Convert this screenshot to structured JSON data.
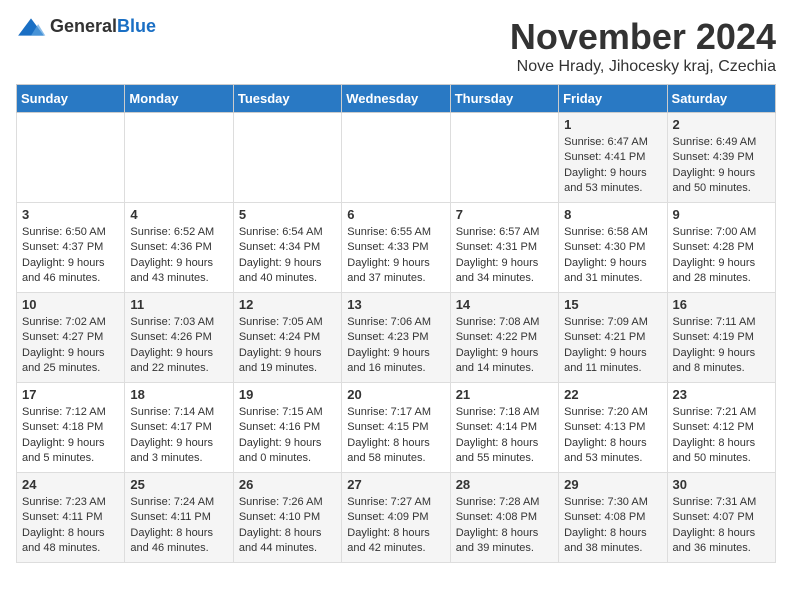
{
  "logo": {
    "general": "General",
    "blue": "Blue"
  },
  "title": "November 2024",
  "location": "Nove Hrady, Jihocesky kraj, Czechia",
  "weekdays": [
    "Sunday",
    "Monday",
    "Tuesday",
    "Wednesday",
    "Thursday",
    "Friday",
    "Saturday"
  ],
  "weeks": [
    [
      {
        "day": "",
        "info": ""
      },
      {
        "day": "",
        "info": ""
      },
      {
        "day": "",
        "info": ""
      },
      {
        "day": "",
        "info": ""
      },
      {
        "day": "",
        "info": ""
      },
      {
        "day": "1",
        "info": "Sunrise: 6:47 AM\nSunset: 4:41 PM\nDaylight: 9 hours\nand 53 minutes."
      },
      {
        "day": "2",
        "info": "Sunrise: 6:49 AM\nSunset: 4:39 PM\nDaylight: 9 hours\nand 50 minutes."
      }
    ],
    [
      {
        "day": "3",
        "info": "Sunrise: 6:50 AM\nSunset: 4:37 PM\nDaylight: 9 hours\nand 46 minutes."
      },
      {
        "day": "4",
        "info": "Sunrise: 6:52 AM\nSunset: 4:36 PM\nDaylight: 9 hours\nand 43 minutes."
      },
      {
        "day": "5",
        "info": "Sunrise: 6:54 AM\nSunset: 4:34 PM\nDaylight: 9 hours\nand 40 minutes."
      },
      {
        "day": "6",
        "info": "Sunrise: 6:55 AM\nSunset: 4:33 PM\nDaylight: 9 hours\nand 37 minutes."
      },
      {
        "day": "7",
        "info": "Sunrise: 6:57 AM\nSunset: 4:31 PM\nDaylight: 9 hours\nand 34 minutes."
      },
      {
        "day": "8",
        "info": "Sunrise: 6:58 AM\nSunset: 4:30 PM\nDaylight: 9 hours\nand 31 minutes."
      },
      {
        "day": "9",
        "info": "Sunrise: 7:00 AM\nSunset: 4:28 PM\nDaylight: 9 hours\nand 28 minutes."
      }
    ],
    [
      {
        "day": "10",
        "info": "Sunrise: 7:02 AM\nSunset: 4:27 PM\nDaylight: 9 hours\nand 25 minutes."
      },
      {
        "day": "11",
        "info": "Sunrise: 7:03 AM\nSunset: 4:26 PM\nDaylight: 9 hours\nand 22 minutes."
      },
      {
        "day": "12",
        "info": "Sunrise: 7:05 AM\nSunset: 4:24 PM\nDaylight: 9 hours\nand 19 minutes."
      },
      {
        "day": "13",
        "info": "Sunrise: 7:06 AM\nSunset: 4:23 PM\nDaylight: 9 hours\nand 16 minutes."
      },
      {
        "day": "14",
        "info": "Sunrise: 7:08 AM\nSunset: 4:22 PM\nDaylight: 9 hours\nand 14 minutes."
      },
      {
        "day": "15",
        "info": "Sunrise: 7:09 AM\nSunset: 4:21 PM\nDaylight: 9 hours\nand 11 minutes."
      },
      {
        "day": "16",
        "info": "Sunrise: 7:11 AM\nSunset: 4:19 PM\nDaylight: 9 hours\nand 8 minutes."
      }
    ],
    [
      {
        "day": "17",
        "info": "Sunrise: 7:12 AM\nSunset: 4:18 PM\nDaylight: 9 hours\nand 5 minutes."
      },
      {
        "day": "18",
        "info": "Sunrise: 7:14 AM\nSunset: 4:17 PM\nDaylight: 9 hours\nand 3 minutes."
      },
      {
        "day": "19",
        "info": "Sunrise: 7:15 AM\nSunset: 4:16 PM\nDaylight: 9 hours\nand 0 minutes."
      },
      {
        "day": "20",
        "info": "Sunrise: 7:17 AM\nSunset: 4:15 PM\nDaylight: 8 hours\nand 58 minutes."
      },
      {
        "day": "21",
        "info": "Sunrise: 7:18 AM\nSunset: 4:14 PM\nDaylight: 8 hours\nand 55 minutes."
      },
      {
        "day": "22",
        "info": "Sunrise: 7:20 AM\nSunset: 4:13 PM\nDaylight: 8 hours\nand 53 minutes."
      },
      {
        "day": "23",
        "info": "Sunrise: 7:21 AM\nSunset: 4:12 PM\nDaylight: 8 hours\nand 50 minutes."
      }
    ],
    [
      {
        "day": "24",
        "info": "Sunrise: 7:23 AM\nSunset: 4:11 PM\nDaylight: 8 hours\nand 48 minutes."
      },
      {
        "day": "25",
        "info": "Sunrise: 7:24 AM\nSunset: 4:11 PM\nDaylight: 8 hours\nand 46 minutes."
      },
      {
        "day": "26",
        "info": "Sunrise: 7:26 AM\nSunset: 4:10 PM\nDaylight: 8 hours\nand 44 minutes."
      },
      {
        "day": "27",
        "info": "Sunrise: 7:27 AM\nSunset: 4:09 PM\nDaylight: 8 hours\nand 42 minutes."
      },
      {
        "day": "28",
        "info": "Sunrise: 7:28 AM\nSunset: 4:08 PM\nDaylight: 8 hours\nand 39 minutes."
      },
      {
        "day": "29",
        "info": "Sunrise: 7:30 AM\nSunset: 4:08 PM\nDaylight: 8 hours\nand 38 minutes."
      },
      {
        "day": "30",
        "info": "Sunrise: 7:31 AM\nSunset: 4:07 PM\nDaylight: 8 hours\nand 36 minutes."
      }
    ]
  ]
}
